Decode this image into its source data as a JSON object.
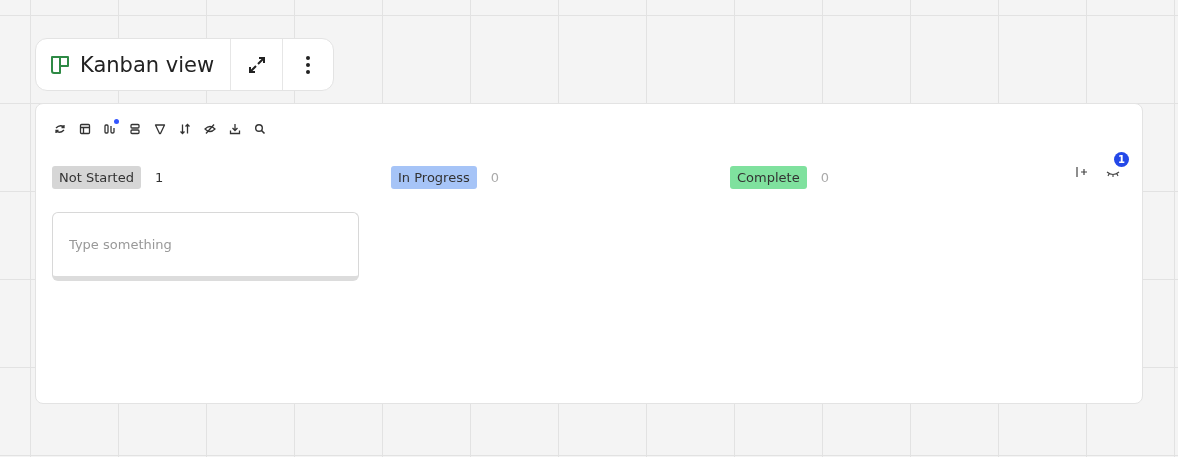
{
  "header": {
    "title": "Kanban view"
  },
  "toolbar": [
    {
      "kind": "refresh",
      "dot": false
    },
    {
      "kind": "layout",
      "dot": false
    },
    {
      "kind": "columns",
      "dot": true
    },
    {
      "kind": "group",
      "dot": false
    },
    {
      "kind": "filter",
      "dot": false
    },
    {
      "kind": "sort",
      "dot": false
    },
    {
      "kind": "hide",
      "dot": false
    },
    {
      "kind": "download",
      "dot": false
    },
    {
      "kind": "search",
      "dot": false
    }
  ],
  "columns": [
    {
      "label": "Not Started",
      "color": "#d6d6d6",
      "count": "1",
      "cards": [
        {
          "placeholder": "Type something"
        }
      ]
    },
    {
      "label": "In Progress",
      "color": "#a6c4f7",
      "count": "0"
    },
    {
      "label": "Complete",
      "color": "#7fe19e",
      "count": "0"
    }
  ],
  "hidden_columns": {
    "badge": "1"
  }
}
